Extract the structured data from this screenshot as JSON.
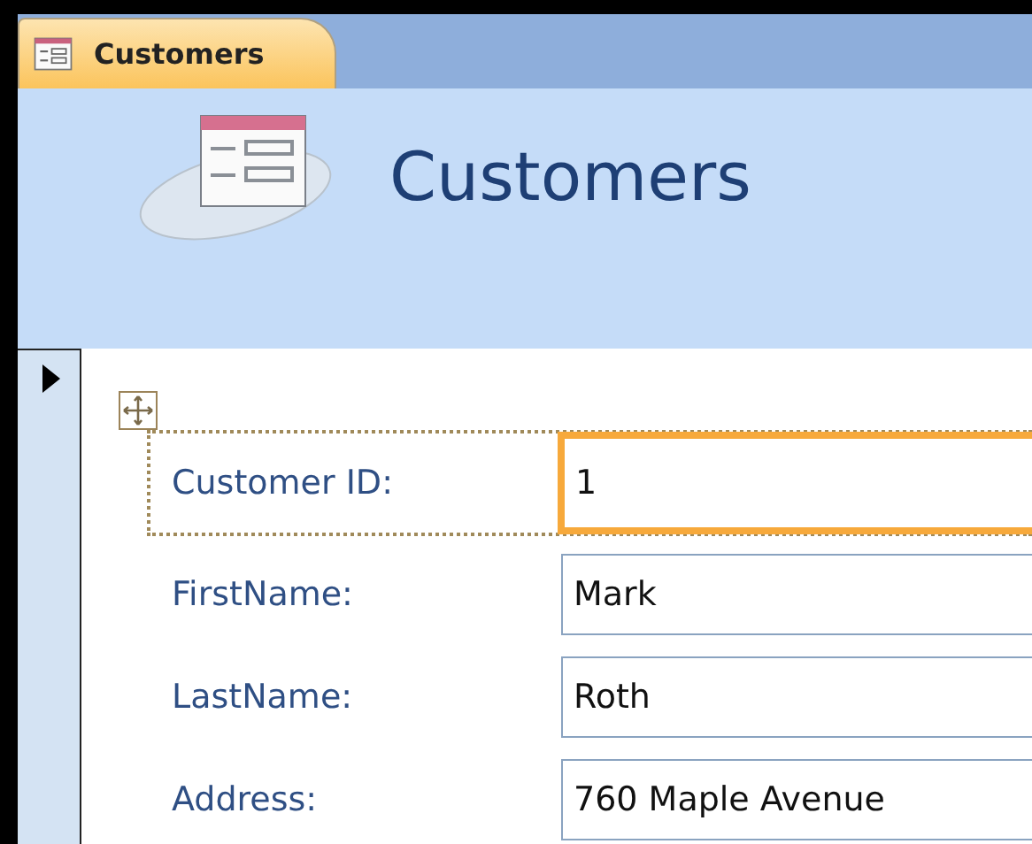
{
  "document_tab": {
    "label": "Customers",
    "selected": true
  },
  "form_header": {
    "title": "Customers"
  },
  "record_selector": {
    "current": true
  },
  "fields": [
    {
      "label": "Customer ID:",
      "value": "1",
      "focused": true
    },
    {
      "label": "FirstName:",
      "value": "Mark",
      "focused": false
    },
    {
      "label": "LastName:",
      "value": "Roth",
      "focused": false
    },
    {
      "label": "Address:",
      "value": "760 Maple Avenue",
      "focused": false
    }
  ]
}
